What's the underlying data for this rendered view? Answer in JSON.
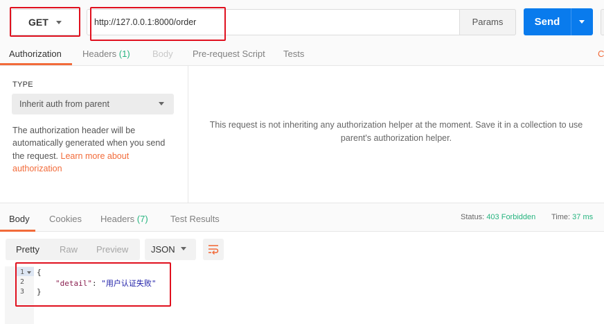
{
  "request": {
    "method": "GET",
    "url": "http://127.0.0.1:8000/order",
    "params_label": "Params",
    "send_label": "Send"
  },
  "request_tabs": {
    "authorization": "Authorization",
    "headers": "Headers",
    "headers_count": "(1)",
    "body": "Body",
    "prerequest": "Pre-request Script",
    "tests": "Tests",
    "cut_link": "Co"
  },
  "auth": {
    "type_label": "TYPE",
    "type_value": "Inherit auth from parent",
    "description": "The authorization header will be automatically generated when you send the request.",
    "learn_more": "Learn more about authorization",
    "message_line1": "This request is not inheriting any authorization helper at the moment. Save it in a collection to use",
    "message_line2": "parent's authorization helper."
  },
  "response_tabs": {
    "body": "Body",
    "cookies": "Cookies",
    "headers": "Headers",
    "headers_count": "(7)",
    "test_results": "Test Results"
  },
  "status": {
    "status_label": "Status:",
    "status_value": "403 Forbidden",
    "time_label": "Time:",
    "time_value": "37 ms"
  },
  "response_view": {
    "pretty": "Pretty",
    "raw": "Raw",
    "preview": "Preview",
    "format": "JSON"
  },
  "response_body": {
    "line_numbers": [
      "1",
      "2",
      "3"
    ],
    "open_brace": "{",
    "key": "\"detail\"",
    "colon": ": ",
    "value": "\"用户认证失败\"",
    "close_brace": "}"
  },
  "colors": {
    "accent_orange": "#f26b3a",
    "send_blue": "#097bed",
    "status_green": "#26b47f",
    "highlight_red": "#e0101e"
  }
}
